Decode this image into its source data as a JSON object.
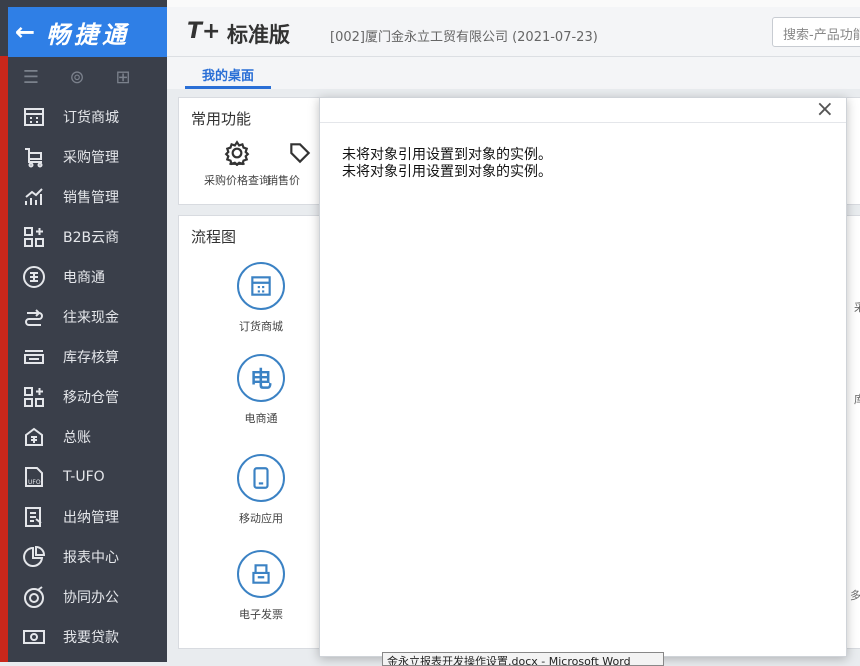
{
  "sidebar": {
    "back_icon": "←",
    "brand": "畅捷通",
    "tools": [
      "menu-icon",
      "settings-icon",
      "add-icon"
    ],
    "items": [
      {
        "label": "订货商城",
        "icon": "store-icon"
      },
      {
        "label": "采购管理",
        "icon": "cart-icon"
      },
      {
        "label": "销售管理",
        "icon": "chart-up-icon"
      },
      {
        "label": "B2B云商",
        "icon": "grid-plus-icon"
      },
      {
        "label": "电商通",
        "icon": "e-circle-icon"
      },
      {
        "label": "往来现金",
        "icon": "exchange-icon"
      },
      {
        "label": "库存核算",
        "icon": "printer-icon"
      },
      {
        "label": "移动仓管",
        "icon": "grid-plus-icon"
      },
      {
        "label": "总账",
        "icon": "ledger-icon"
      },
      {
        "label": "T-UFO",
        "icon": "ufo-icon"
      },
      {
        "label": "出纳管理",
        "icon": "cashier-icon"
      },
      {
        "label": "报表中心",
        "icon": "pie-icon"
      },
      {
        "label": "协同办公",
        "icon": "target-icon"
      },
      {
        "label": "我要贷款",
        "icon": "money-icon"
      }
    ]
  },
  "header": {
    "product_mark": "T+",
    "product_title": "标准版",
    "company": "[002]厦门金永立工贸有限公司   (2021-07-23)",
    "search_placeholder": "搜索-产品功能"
  },
  "tabs": [
    {
      "label": "我的桌面",
      "active": true
    }
  ],
  "panels": {
    "common": {
      "title": "常用功能",
      "items": [
        {
          "label": "采购价格查询",
          "icon": "gear-icon"
        },
        {
          "label": "销售价",
          "icon": "tag-icon"
        }
      ]
    },
    "flow": {
      "title": "流程图",
      "items": [
        {
          "label": "订货商城",
          "icon": "store-icon"
        },
        {
          "label": "电商通",
          "icon": "e-circle-icon"
        },
        {
          "label": "移动应用",
          "icon": "tablet-icon"
        },
        {
          "label": "电子发票",
          "icon": "invoice-icon"
        }
      ]
    }
  },
  "edge_chars": [
    "采",
    "库",
    "多"
  ],
  "dialog": {
    "close_icon": "×",
    "message_line1": "未将对象引用设置到对象的实例。",
    "message_line2": "未将对象引用设置到对象的实例。"
  },
  "taskbar_tip": "金永立报表开发操作设置.docx - Microsoft Word",
  "colors": {
    "sidebar_bg": "#3a3f4a",
    "brand_blue": "#2f7fe6",
    "accent": "#2a6fd6",
    "icon_blue": "#3b82c4"
  }
}
